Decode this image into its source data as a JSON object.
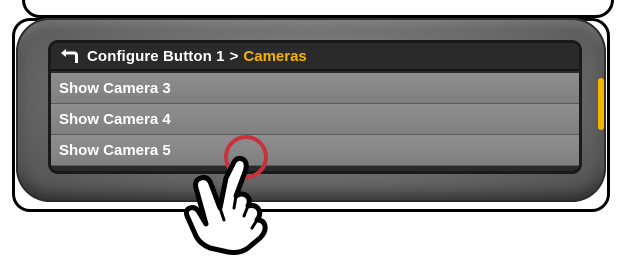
{
  "colors": {
    "accent": "#f5b400",
    "touch_indicator": "#c8323a"
  },
  "header": {
    "back_icon": "back-arrow-icon",
    "parent_label": "Configure Button 1",
    "separator": ">",
    "current_label": "Cameras"
  },
  "list": {
    "items": [
      {
        "label": "Show Camera 3"
      },
      {
        "label": "Show Camera 4"
      },
      {
        "label": "Show Camera 5"
      }
    ]
  },
  "overlay": {
    "touch_icon": "pointing-hand-icon"
  }
}
